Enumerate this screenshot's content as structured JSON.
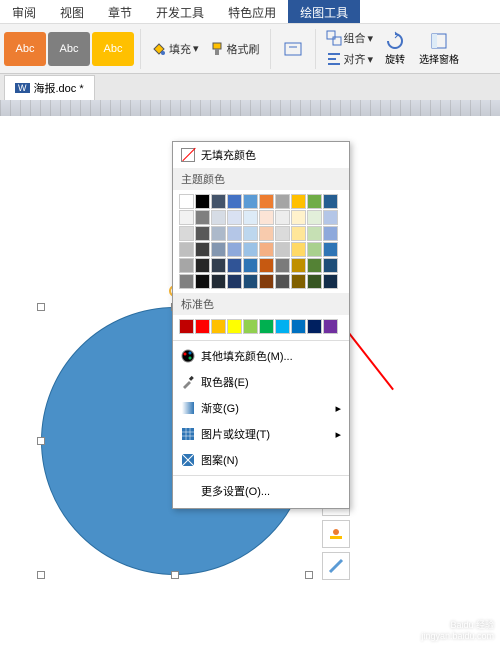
{
  "tabs": [
    "审阅",
    "视图",
    "章节",
    "开发工具",
    "特色应用",
    "绘图工具"
  ],
  "activeTab": 5,
  "styleBoxes": [
    "Abc",
    "Abc",
    "Abc"
  ],
  "toolbar": {
    "fill": "填充",
    "formatPainter": "格式刷",
    "group": "组合",
    "align": "对齐",
    "rotate": "旋转",
    "selectPane": "选择窗格"
  },
  "docTab": {
    "icon": "W",
    "name": "海报.doc *"
  },
  "fillMenu": {
    "noFill": "无填充颜色",
    "themeColors": "主题颜色",
    "standardColors": "标准色",
    "moreColors": "其他填充颜色(M)...",
    "eyedropper": "取色器(E)",
    "gradient": "渐变(G)",
    "pictureTexture": "图片或纹理(T)",
    "pattern": "图案(N)",
    "moreSettings": "更多设置(O)..."
  },
  "themeSwatches": [
    "#ffffff",
    "#000000",
    "#44546a",
    "#4472c4",
    "#5b9bd5",
    "#ed7d31",
    "#a5a5a5",
    "#ffc000",
    "#70ad47",
    "#255e91",
    "#f2f2f2",
    "#7f7f7f",
    "#d6dce5",
    "#d9e1f2",
    "#ddebf7",
    "#fce4d6",
    "#ededed",
    "#fff2cc",
    "#e2efda",
    "#b4c6e7",
    "#d9d9d9",
    "#595959",
    "#acb9ca",
    "#b4c6e7",
    "#bdd7ee",
    "#f8cbad",
    "#dbdbdb",
    "#ffe699",
    "#c6e0b4",
    "#8ea9db",
    "#bfbfbf",
    "#404040",
    "#8497b0",
    "#8ea9db",
    "#9bc2e6",
    "#f4b084",
    "#c9c9c9",
    "#ffd966",
    "#a9d08e",
    "#2f75b5",
    "#a6a6a6",
    "#262626",
    "#333f4f",
    "#305496",
    "#2f75b5",
    "#c65911",
    "#7b7b7b",
    "#bf8f00",
    "#548235",
    "#1f4e78",
    "#808080",
    "#0d0d0d",
    "#222b35",
    "#203764",
    "#1f4e78",
    "#833c0c",
    "#525252",
    "#806000",
    "#375623",
    "#132d4a"
  ],
  "standardSwatches": [
    "#c00000",
    "#ff0000",
    "#ffc000",
    "#ffff00",
    "#92d050",
    "#00b050",
    "#00b0f0",
    "#0070c0",
    "#002060",
    "#7030a0"
  ],
  "watermark": {
    "brand": "Baidu 经验",
    "url": "jingyan.baidu.com"
  }
}
